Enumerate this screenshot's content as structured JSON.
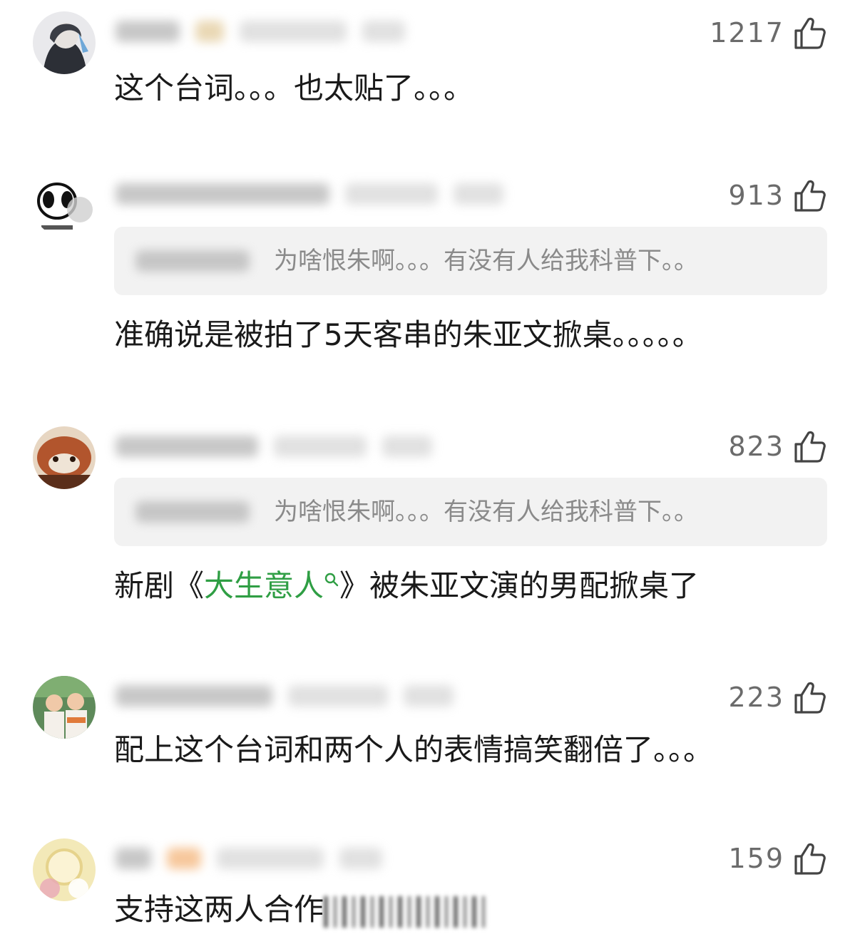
{
  "comments": [
    {
      "likes": "1217",
      "text": "这个台词。。。也太贴了。。。",
      "avatar_colors": [
        "#3a3d45",
        "#d8d8dc",
        "#6fa8d8"
      ]
    },
    {
      "likes": "913",
      "reply_to": "为啥恨朱啊。。。有没有人给我科普下。。",
      "text": "准确说是被拍了5天客串的朱亚文掀桌。。。。。",
      "avatar_colors": [
        "#ffffff",
        "#111111",
        "#cfcfcf"
      ]
    },
    {
      "likes": "823",
      "reply_to": "为啥恨朱啊。。。有没有人给我科普下。。",
      "text_before": "新剧《",
      "topic": "大生意人",
      "text_after": "》被朱亚文演的男配掀桌了",
      "avatar_colors": [
        "#b2552d",
        "#e7d6c2",
        "#5a2e1a"
      ]
    },
    {
      "likes": "223",
      "text": "配上这个台词和两个人的表情搞笑翻倍了。。。",
      "avatar_colors": [
        "#5e8a5a",
        "#f0c9a8",
        "#e07a3a"
      ]
    },
    {
      "likes": "159",
      "text": "支持这两人合作",
      "avatar_colors": [
        "#f3e9b8",
        "#e8a7b8",
        "#ffffff"
      ]
    }
  ],
  "colors": {
    "topic": "#2f9e44",
    "likes": "#6b6b6b",
    "quote_bg": "#f2f2f2"
  }
}
